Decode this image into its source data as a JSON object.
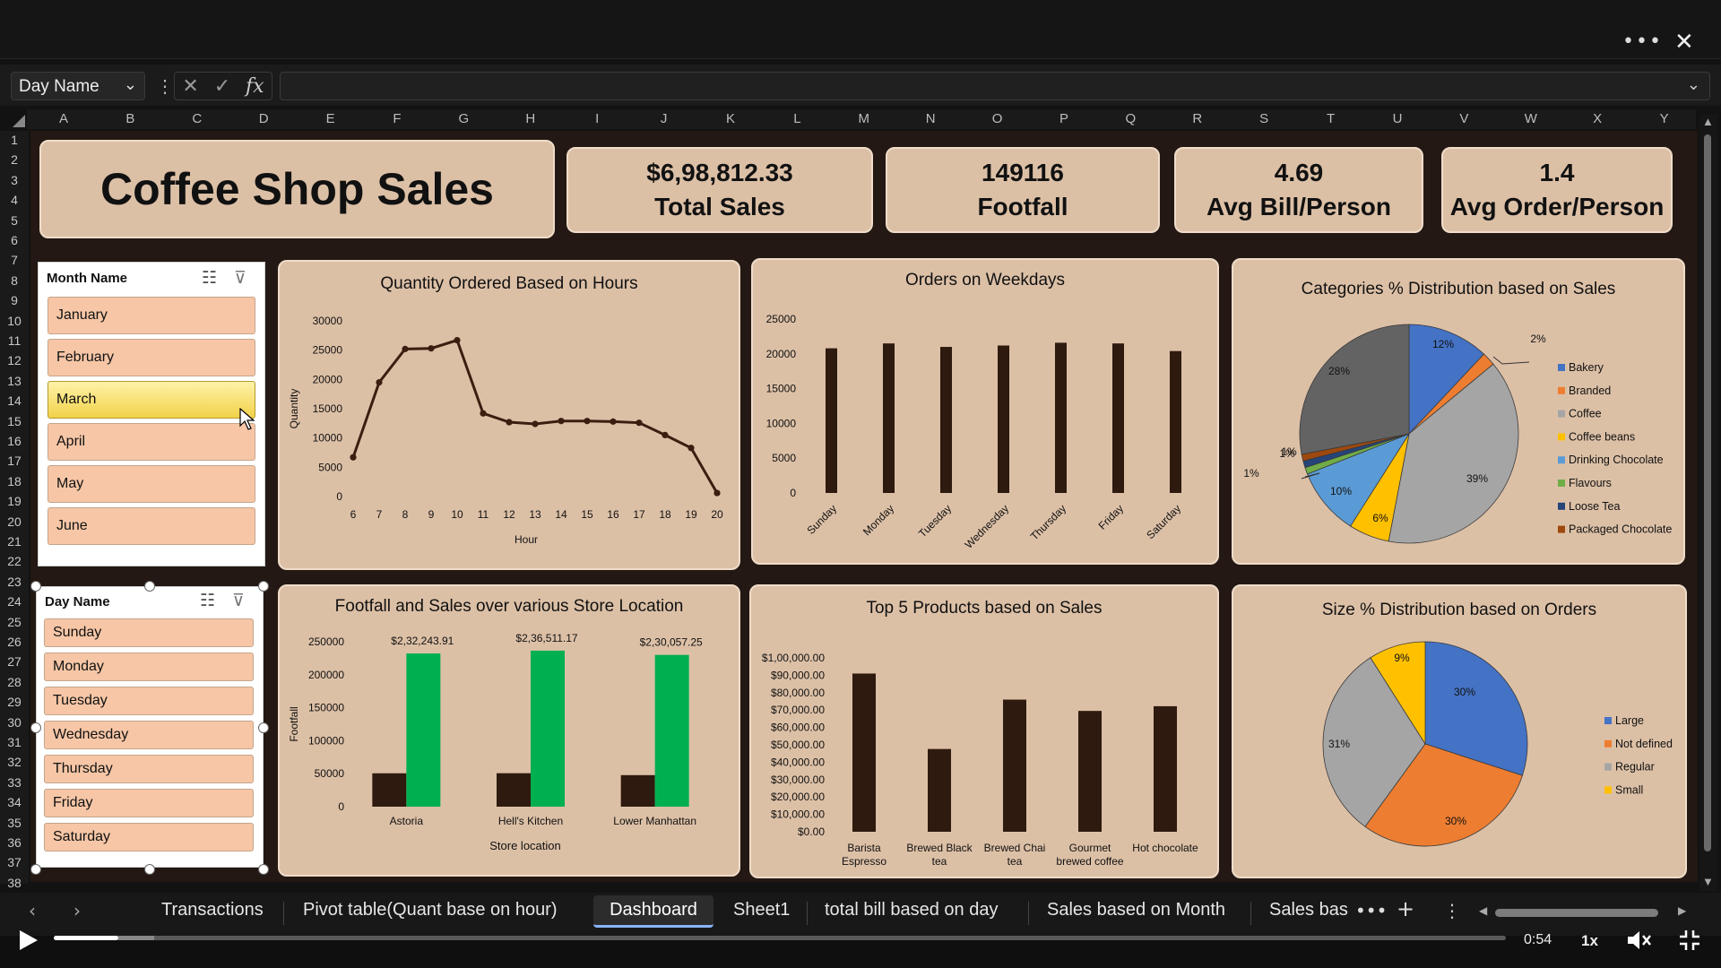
{
  "formula_bar": {
    "name_box": "Day Name",
    "fx": "fx"
  },
  "columns": [
    "A",
    "B",
    "C",
    "D",
    "E",
    "F",
    "G",
    "H",
    "I",
    "J",
    "K",
    "L",
    "M",
    "N",
    "O",
    "P",
    "Q",
    "R",
    "S",
    "T",
    "U",
    "V",
    "W",
    "X",
    "Y"
  ],
  "rows": [
    "1",
    "2",
    "3",
    "4",
    "5",
    "6",
    "7",
    "8",
    "9",
    "10",
    "11",
    "12",
    "13",
    "14",
    "15",
    "16",
    "17",
    "18",
    "19",
    "20",
    "21",
    "22",
    "23",
    "24",
    "25",
    "26",
    "27",
    "28",
    "29",
    "30",
    "31",
    "32",
    "33",
    "34",
    "35",
    "36",
    "37",
    "38"
  ],
  "dashboard": {
    "title": "Coffee Shop Sales",
    "kpis": [
      {
        "value": "$6,98,812.33",
        "label": "Total Sales"
      },
      {
        "value": "149116",
        "label": "Footfall"
      },
      {
        "value": "4.69",
        "label": "Avg Bill/Person"
      },
      {
        "value": "1.4",
        "label": "Avg Order/Person"
      }
    ]
  },
  "month_slicer": {
    "header": "Month Name",
    "items": [
      "January",
      "February",
      "March",
      "April",
      "May",
      "June"
    ],
    "selected": "March"
  },
  "day_slicer": {
    "header": "Day Name",
    "items": [
      "Sunday",
      "Monday",
      "Tuesday",
      "Wednesday",
      "Thursday",
      "Friday",
      "Saturday"
    ]
  },
  "colors": {
    "line": "#3a1f10",
    "bar_dark": "#2e1a0e",
    "bar_green": "#00b050",
    "card": "#dcc0a6",
    "sheet_bg": "#231813"
  },
  "chart_data": [
    {
      "type": "line",
      "title": "Quantity Ordered Based on Hours",
      "xlabel": "Hour",
      "ylabel": "Quantity",
      "x": [
        6,
        7,
        8,
        9,
        10,
        11,
        12,
        13,
        14,
        15,
        16,
        17,
        18,
        19,
        20
      ],
      "values": [
        6700,
        19500,
        25200,
        25300,
        26700,
        14200,
        12700,
        12400,
        12900,
        12900,
        12800,
        12600,
        10500,
        8300,
        600
      ],
      "yticks": [
        0,
        5000,
        10000,
        15000,
        20000,
        25000,
        30000
      ],
      "ylim": [
        0,
        30000
      ]
    },
    {
      "type": "bar",
      "title": "Orders on Weekdays",
      "categories": [
        "Sunday",
        "Monday",
        "Tuesday",
        "Wednesday",
        "Thursday",
        "Friday",
        "Saturday"
      ],
      "values": [
        20800,
        21500,
        21000,
        21200,
        21600,
        21500,
        20400
      ],
      "yticks": [
        0,
        5000,
        10000,
        15000,
        20000,
        25000
      ],
      "ylim": [
        0,
        25000
      ]
    },
    {
      "type": "pie",
      "title": "Categories % Distribution based on Sales",
      "legend": [
        "Bakery",
        "Branded",
        "Coffee",
        "Coffee beans",
        "Drinking Chocolate",
        "Flavours",
        "Loose Tea",
        "Packaged Chocolate"
      ],
      "slices": [
        {
          "label": "12%",
          "value": 12,
          "color": "#4472c4"
        },
        {
          "label": "2%",
          "value": 2,
          "color": "#ed7d31"
        },
        {
          "label": "39%",
          "value": 39,
          "color": "#a5a5a5"
        },
        {
          "label": "6%",
          "value": 6,
          "color": "#ffc000"
        },
        {
          "label": "10%",
          "value": 10,
          "color": "#5b9bd5"
        },
        {
          "label": "1%",
          "value": 1,
          "color": "#70ad47"
        },
        {
          "label": "1%",
          "value": 1,
          "color": "#264478"
        },
        {
          "label": "1%",
          "value": 1,
          "color": "#9e480e"
        },
        {
          "label": "28%",
          "value": 28,
          "color": "#636363"
        }
      ],
      "legend_colors": [
        "#4472c4",
        "#ed7d31",
        "#a5a5a5",
        "#ffc000",
        "#5b9bd5",
        "#70ad47",
        "#264478",
        "#9e480e"
      ]
    },
    {
      "type": "bar",
      "title": "Footfall and Sales over various Store Location",
      "xlabel": "Store location",
      "ylabel": "Footfall",
      "categories": [
        "Astoria",
        "Hell's Kitchen",
        "Lower Manhattan"
      ],
      "series": [
        {
          "values": [
            50600,
            50700,
            47800
          ]
        },
        {
          "values": [
            232244,
            236511,
            230057
          ]
        }
      ],
      "data_labels": [
        "$2,32,243.91",
        "$2,36,511.17",
        "$2,30,057.25"
      ],
      "yticks": [
        0,
        50000,
        100000,
        150000,
        200000,
        250000
      ],
      "ylim": [
        0,
        250000
      ]
    },
    {
      "type": "bar",
      "title": "Top 5 Products based on Sales",
      "categories": [
        "Barista Espresso",
        "Brewed Black tea",
        "Brewed Chai tea",
        "Gourmet brewed coffee",
        "Hot chocolate"
      ],
      "category_lines": [
        [
          "Barista",
          "Espresso"
        ],
        [
          "Brewed Black",
          "tea"
        ],
        [
          "Brewed Chai",
          "tea"
        ],
        [
          "Gourmet",
          "brewed coffee"
        ],
        [
          "Hot chocolate"
        ]
      ],
      "values": [
        91000,
        47600,
        76000,
        69500,
        72200
      ],
      "yticks": [
        "$0.00",
        "$10,000.00",
        "$20,000.00",
        "$30,000.00",
        "$40,000.00",
        "$50,000.00",
        "$60,000.00",
        "$70,000.00",
        "$80,000.00",
        "$90,000.00",
        "$1,00,000.00"
      ],
      "ylim": [
        0,
        100000
      ]
    },
    {
      "type": "pie",
      "title": "Size % Distribution based on Orders",
      "legend": [
        "Large",
        "Not defined",
        "Regular",
        "Small"
      ],
      "slices": [
        {
          "label": "30%",
          "value": 30,
          "color": "#4472c4"
        },
        {
          "label": "30%",
          "value": 30,
          "color": "#ed7d31"
        },
        {
          "label": "31%",
          "value": 31,
          "color": "#a5a5a5"
        },
        {
          "label": "9%",
          "value": 9,
          "color": "#ffc000"
        }
      ],
      "legend_colors": [
        "#4472c4",
        "#ed7d31",
        "#a5a5a5",
        "#ffc000"
      ]
    }
  ],
  "tabs": [
    "Transactions",
    "Pivot table(Quant base on hour)",
    "Dashboard",
    "Sheet1",
    "total bill based on day",
    "Sales based on Month",
    "Sales bas"
  ],
  "active_tab": "Dashboard",
  "player": {
    "time": "0:54",
    "speed": "1x",
    "progress": 0.05
  }
}
